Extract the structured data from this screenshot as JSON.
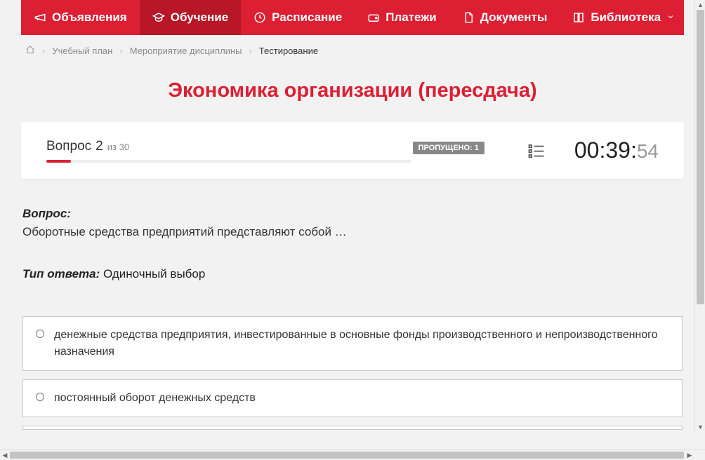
{
  "nav": {
    "items": [
      {
        "label": "Объявления",
        "icon": "megaphone"
      },
      {
        "label": "Обучение",
        "icon": "graduation",
        "active": true
      },
      {
        "label": "Расписание",
        "icon": "clock"
      },
      {
        "label": "Платежи",
        "icon": "wallet"
      },
      {
        "label": "Документы",
        "icon": "document"
      },
      {
        "label": "Библиотека",
        "icon": "book",
        "dropdown": true
      }
    ]
  },
  "breadcrumb": {
    "items": [
      {
        "label": "Учебный план"
      },
      {
        "label": "Мероприятие дисциплины"
      },
      {
        "label": "Тестирование",
        "current": true
      }
    ]
  },
  "page_title": "Экономика организации (пересдача)",
  "question_bar": {
    "word": "Вопрос",
    "number": "2",
    "of_prefix": "из",
    "total": "30",
    "missed_label": "ПРОПУЩЕНО: 1",
    "progress_percent": 6.7
  },
  "timer": {
    "hh": "00",
    "mm": "39",
    "ss": "54"
  },
  "question": {
    "label": "Вопрос:",
    "text": "Оборотные средства предприятий представляют собой …"
  },
  "answer_type": {
    "label": "Тип ответа:",
    "value": "Одиночный выбор"
  },
  "options": [
    {
      "text": "денежные средства предприятия, инвестированные в основные фонды производственного и непроизводственного назначения"
    },
    {
      "text": "постоянный оборот денежных средств"
    }
  ]
}
